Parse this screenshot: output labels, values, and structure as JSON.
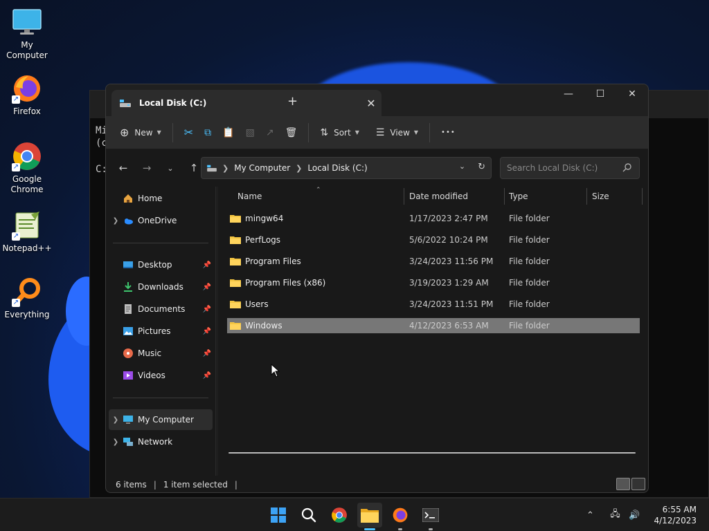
{
  "desktop": {
    "icons": [
      {
        "label": "My Computer",
        "icon": "monitor-icon"
      },
      {
        "label": "Firefox",
        "icon": "firefox-icon"
      },
      {
        "label": "Google Chrome",
        "icon": "chrome-icon"
      },
      {
        "label": "Notepad++",
        "icon": "notepadpp-icon"
      },
      {
        "label": "Everything",
        "icon": "search-magnifier-icon"
      }
    ]
  },
  "terminal": {
    "line1": "Mi",
    "line2": "(c",
    "line3": "C:"
  },
  "explorer": {
    "tab_title": "Local Disk (C:)",
    "new_tab_label": "+",
    "toolbar": {
      "new_label": "New",
      "sort_label": "Sort",
      "view_label": "View",
      "more_label": "•••"
    },
    "address": {
      "crumbs": [
        "My Computer",
        "Local Disk (C:)"
      ]
    },
    "search": {
      "placeholder": "Search Local Disk (C:)"
    },
    "sidebar": {
      "home": "Home",
      "onedrive": "OneDrive",
      "desktop": "Desktop",
      "downloads": "Downloads",
      "documents": "Documents",
      "pictures": "Pictures",
      "music": "Music",
      "videos": "Videos",
      "my_computer": "My Computer",
      "network": "Network"
    },
    "columns": {
      "name": "Name",
      "date": "Date modified",
      "type": "Type",
      "size": "Size"
    },
    "files": [
      {
        "name": "mingw64",
        "date": "1/17/2023 2:47 PM",
        "type": "File folder",
        "selected": false
      },
      {
        "name": "PerfLogs",
        "date": "5/6/2022 10:24 PM",
        "type": "File folder",
        "selected": false
      },
      {
        "name": "Program Files",
        "date": "3/24/2023 11:56 PM",
        "type": "File folder",
        "selected": false
      },
      {
        "name": "Program Files (x86)",
        "date": "3/19/2023 1:29 AM",
        "type": "File folder",
        "selected": false
      },
      {
        "name": "Users",
        "date": "3/24/2023 11:51 PM",
        "type": "File folder",
        "selected": false
      },
      {
        "name": "Windows",
        "date": "4/12/2023 6:53 AM",
        "type": "File folder",
        "selected": true
      }
    ],
    "status": {
      "count": "6 items",
      "selection": "1 item selected"
    }
  },
  "taskbar": {
    "clock_time": "6:55 AM",
    "clock_date": "4/12/2023"
  },
  "colors": {
    "folder": "#f4c542",
    "accent": "#4cc2ff",
    "selection": "#777777"
  }
}
